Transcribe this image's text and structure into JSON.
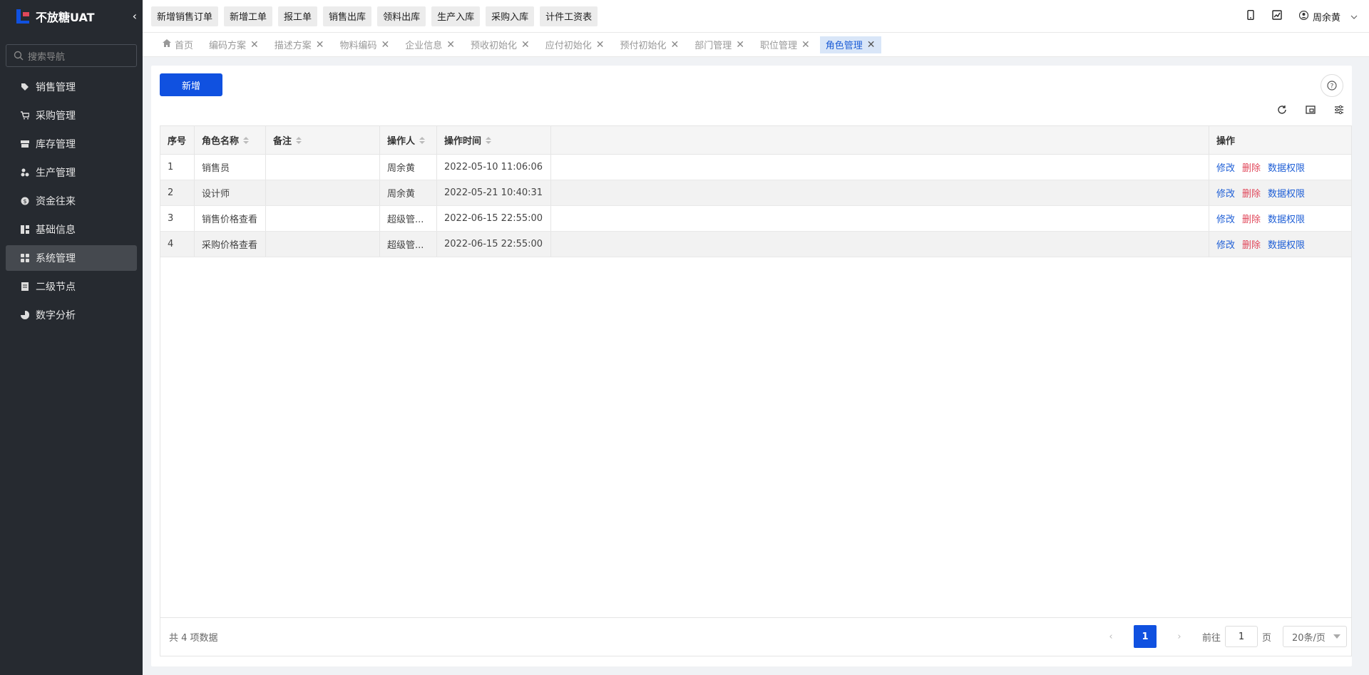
{
  "app": {
    "title": "不放糖UAT"
  },
  "sidebar": {
    "search_placeholder": "搜索导航",
    "items": [
      {
        "label": "销售管理",
        "icon": "tag-icon"
      },
      {
        "label": "采购管理",
        "icon": "cart-icon"
      },
      {
        "label": "库存管理",
        "icon": "warehouse-icon"
      },
      {
        "label": "生产管理",
        "icon": "factory-icon"
      },
      {
        "label": "资金往来",
        "icon": "money-icon"
      },
      {
        "label": "基础信息",
        "icon": "grid-icon"
      },
      {
        "label": "系统管理",
        "icon": "apps-icon",
        "active": true
      },
      {
        "label": "二级节点",
        "icon": "doc-icon"
      },
      {
        "label": "数字分析",
        "icon": "pie-icon"
      }
    ]
  },
  "topbar": {
    "quick_actions": [
      "新增销售订单",
      "新增工单",
      "报工单",
      "销售出库",
      "领料出库",
      "生产入库",
      "采购入库",
      "计件工资表"
    ],
    "user_name": "周余黄"
  },
  "tabs": [
    {
      "label": "首页",
      "closable": false
    },
    {
      "label": "编码方案",
      "closable": true
    },
    {
      "label": "描述方案",
      "closable": true
    },
    {
      "label": "物料编码",
      "closable": true
    },
    {
      "label": "企业信息",
      "closable": true
    },
    {
      "label": "预收初始化",
      "closable": true
    },
    {
      "label": "应付初始化",
      "closable": true
    },
    {
      "label": "预付初始化",
      "closable": true
    },
    {
      "label": "部门管理",
      "closable": true
    },
    {
      "label": "职位管理",
      "closable": true
    },
    {
      "label": "角色管理",
      "closable": true,
      "active": true
    }
  ],
  "toolbar": {
    "add_label": "新增"
  },
  "table": {
    "headers": [
      "序号",
      "角色名称",
      "备注",
      "操作人",
      "操作时间",
      "",
      "操作"
    ],
    "rows": [
      {
        "no": "1",
        "name": "销售员",
        "remark": "",
        "operator": "周余黄",
        "time": "2022-05-10 11:06:06"
      },
      {
        "no": "2",
        "name": "设计师",
        "remark": "",
        "operator": "周余黄",
        "time": "2022-05-21 10:40:31"
      },
      {
        "no": "3",
        "name": "销售价格查看",
        "remark": "",
        "operator": "超级管...",
        "time": "2022-06-15 22:55:00"
      },
      {
        "no": "4",
        "name": "采购价格查看",
        "remark": "",
        "operator": "超级管...",
        "time": "2022-06-15 22:55:00"
      }
    ],
    "actions": {
      "edit": "修改",
      "delete": "删除",
      "data_perm": "数据权限"
    }
  },
  "footer": {
    "total_text": "共 4 项数据",
    "current_page": "1",
    "goto_label": "前往",
    "goto_value": "1",
    "page_unit": "页",
    "page_size": "20条/页"
  },
  "colors": {
    "primary": "#1051e0",
    "sidebar_bg": "#262a30",
    "danger": "#e0475a"
  }
}
